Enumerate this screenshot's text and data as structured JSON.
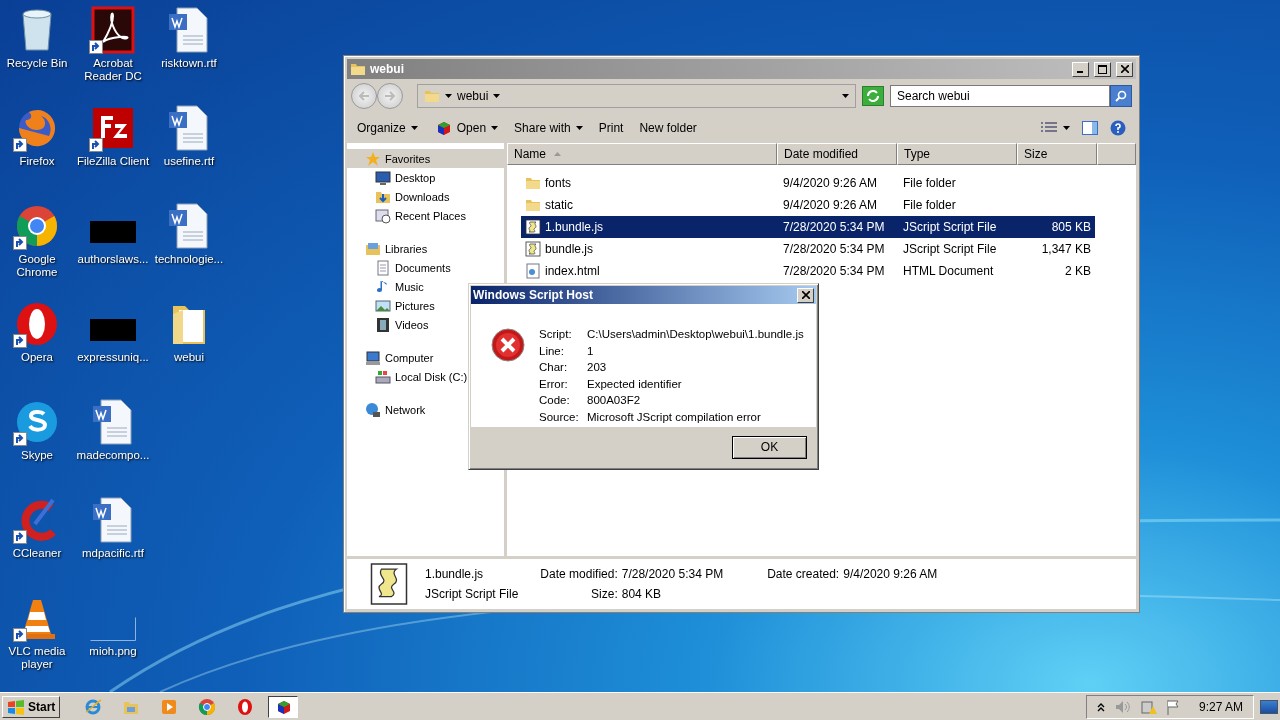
{
  "desktop": {
    "columns": [
      {
        "icons": [
          {
            "label": "Recycle Bin",
            "kind": "recycle",
            "shortcut": false
          },
          {
            "label": "Firefox",
            "kind": "firefox",
            "shortcut": true
          },
          {
            "label": "Google Chrome",
            "kind": "chrome",
            "shortcut": true
          },
          {
            "label": "Opera",
            "kind": "opera",
            "shortcut": true
          },
          {
            "label": "Skype",
            "kind": "skype",
            "shortcut": true
          },
          {
            "label": "CCleaner",
            "kind": "ccleaner",
            "shortcut": true
          },
          {
            "label": "VLC media player",
            "kind": "vlc",
            "shortcut": true
          }
        ]
      },
      {
        "icons": [
          {
            "label": "Acrobat Reader DC",
            "kind": "acrobat",
            "shortcut": true
          },
          {
            "label": "FileZilla Client",
            "kind": "filezilla",
            "shortcut": true
          },
          {
            "label": "authorslaws...",
            "kind": "redacted",
            "shortcut": false
          },
          {
            "label": "expressuniq...",
            "kind": "redacted",
            "shortcut": false
          },
          {
            "label": "madecompo...",
            "kind": "document",
            "shortcut": false
          },
          {
            "label": "mdpacific.rtf",
            "kind": "document",
            "shortcut": false
          },
          {
            "label": "mioh.png",
            "kind": "image",
            "shortcut": false
          }
        ]
      },
      {
        "icons": [
          {
            "label": "risktown.rtf",
            "kind": "document",
            "shortcut": false
          },
          {
            "label": "usefine.rtf",
            "kind": "document",
            "shortcut": false
          },
          {
            "label": "technologie...",
            "kind": "document",
            "shortcut": false
          },
          {
            "label": "webui",
            "kind": "folder",
            "shortcut": false
          }
        ]
      }
    ]
  },
  "explorer": {
    "title": "webui",
    "address": "webui",
    "search": {
      "placeholder": "Search webui"
    },
    "toolbar": [
      {
        "label": "Organize",
        "dropdown": true,
        "icon": false
      },
      {
        "label": "Open",
        "dropdown": true,
        "icon": true
      },
      {
        "label": "Share with",
        "dropdown": true,
        "icon": false
      },
      {
        "label": "Print",
        "dropdown": false,
        "icon": false
      },
      {
        "label": "New folder",
        "dropdown": false,
        "icon": false
      }
    ],
    "nav": [
      {
        "label": "Favorites",
        "kind": "star",
        "selected": true,
        "children": [
          {
            "label": "Desktop",
            "kind": "desktop",
            "selected": false
          },
          {
            "label": "Downloads",
            "kind": "downloads",
            "selected": false
          },
          {
            "label": "Recent Places",
            "kind": "recent",
            "selected": false
          }
        ]
      },
      {
        "label": "Libraries",
        "kind": "library",
        "selected": false,
        "children": [
          {
            "label": "Documents",
            "kind": "documents",
            "selected": false
          },
          {
            "label": "Music",
            "kind": "music",
            "selected": false
          },
          {
            "label": "Pictures",
            "kind": "pictures",
            "selected": false
          },
          {
            "label": "Videos",
            "kind": "videos",
            "selected": false
          }
        ]
      },
      {
        "label": "Computer",
        "kind": "computer",
        "selected": false,
        "children": [
          {
            "label": "Local Disk (C:)",
            "kind": "disk",
            "selected": false
          }
        ]
      },
      {
        "label": "Network",
        "kind": "network",
        "selected": false
      }
    ],
    "columns": [
      {
        "label": "Name",
        "sorted": true
      },
      {
        "label": "Date modified",
        "sorted": false
      },
      {
        "label": "Type",
        "sorted": false
      },
      {
        "label": "Size",
        "sorted": false
      }
    ],
    "rows": [
      {
        "name": "fonts",
        "kind": "folder",
        "date": "9/4/2020 9:26 AM",
        "type": "File folder",
        "selected": false
      },
      {
        "name": "static",
        "kind": "folder",
        "date": "9/4/2020 9:26 AM",
        "type": "File folder",
        "selected": false
      },
      {
        "name": "1.bundle.js",
        "kind": "script",
        "date": "7/28/2020 5:34 PM",
        "type": "JScript Script File",
        "size": "805 KB",
        "selected": true
      },
      {
        "name": "bundle.js",
        "kind": "script",
        "date": "7/28/2020 5:34 PM",
        "type": "JScript Script File",
        "size": "1,347 KB",
        "selected": false
      },
      {
        "name": "index.html",
        "kind": "html",
        "date": "7/28/2020 5:34 PM",
        "type": "HTML Document",
        "size": "2 KB",
        "selected": false
      }
    ],
    "details": {
      "name": "1.bundle.js",
      "type": "JScript Script File",
      "fields": [
        {
          "label": "Date modified:",
          "value": "7/28/2020 5:34 PM"
        },
        {
          "label": "Date created:",
          "value": "9/4/2020 9:26 AM"
        },
        {
          "label": "Size:",
          "value": "804 KB"
        }
      ]
    }
  },
  "dialog": {
    "title": "Windows Script Host",
    "fields": [
      {
        "label": "Script:",
        "value": "C:\\Users\\admin\\Desktop\\webui\\1.bundle.js"
      },
      {
        "label": "Line:",
        "value": "1"
      },
      {
        "label": "Char:",
        "value": "203"
      },
      {
        "label": "Error:",
        "value": "Expected identifier"
      },
      {
        "label": "Code:",
        "value": "800A03F2"
      },
      {
        "label": "Source:",
        "value": "Microsoft JScript compilation error"
      }
    ],
    "button": "OK"
  },
  "taskbar": {
    "start": "Start",
    "apps": [
      {
        "kind": "ie",
        "active": false
      },
      {
        "kind": "explorer",
        "active": false
      },
      {
        "kind": "media",
        "active": false
      },
      {
        "kind": "chrome",
        "active": false
      },
      {
        "kind": "opera",
        "active": false
      },
      {
        "kind": "scripthost",
        "active": true
      }
    ],
    "clock": "9:27 AM"
  }
}
